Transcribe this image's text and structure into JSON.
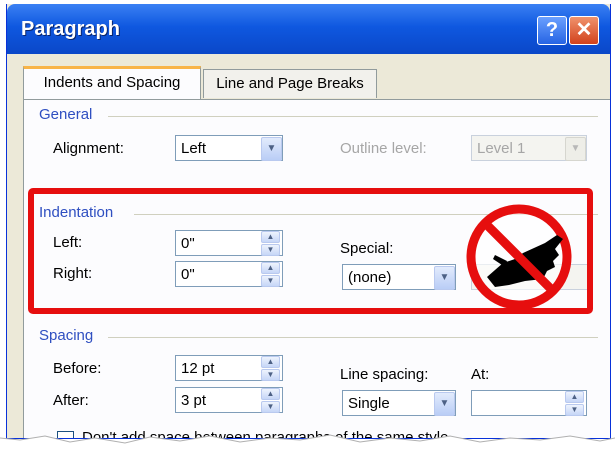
{
  "dialog": {
    "title": "Paragraph",
    "help_glyph": "?",
    "close_glyph": "✕"
  },
  "tabs": [
    {
      "label": "Indents and Spacing",
      "active": true
    },
    {
      "label": "Line and Page Breaks",
      "active": false
    }
  ],
  "general": {
    "heading": "General",
    "alignment_label": "Alignment:",
    "alignment_value": "Left",
    "outline_label": "Outline level:",
    "outline_value": "Level 1"
  },
  "indentation": {
    "heading": "Indentation",
    "left_label": "Left:",
    "left_value": "0\"",
    "right_label": "Right:",
    "right_value": "0\"",
    "special_label": "Special:",
    "special_value": "(none)",
    "no_entry_icon": "no-pointing-hand-icon"
  },
  "spacing": {
    "heading": "Spacing",
    "before_label": "Before:",
    "before_value": "12 pt",
    "after_label": "After:",
    "after_value": "3 pt",
    "line_spacing_label": "Line spacing:",
    "line_spacing_value": "Single",
    "at_label": "At:",
    "at_value": ""
  },
  "options": {
    "dont_add_space_label": "Don't add space between paragraphs of the same style",
    "dont_add_space_checked": false
  },
  "colors": {
    "title_bar": "#0a47c8",
    "highlight_red": "#e60e0e",
    "group_heading": "#2f4fc1"
  }
}
